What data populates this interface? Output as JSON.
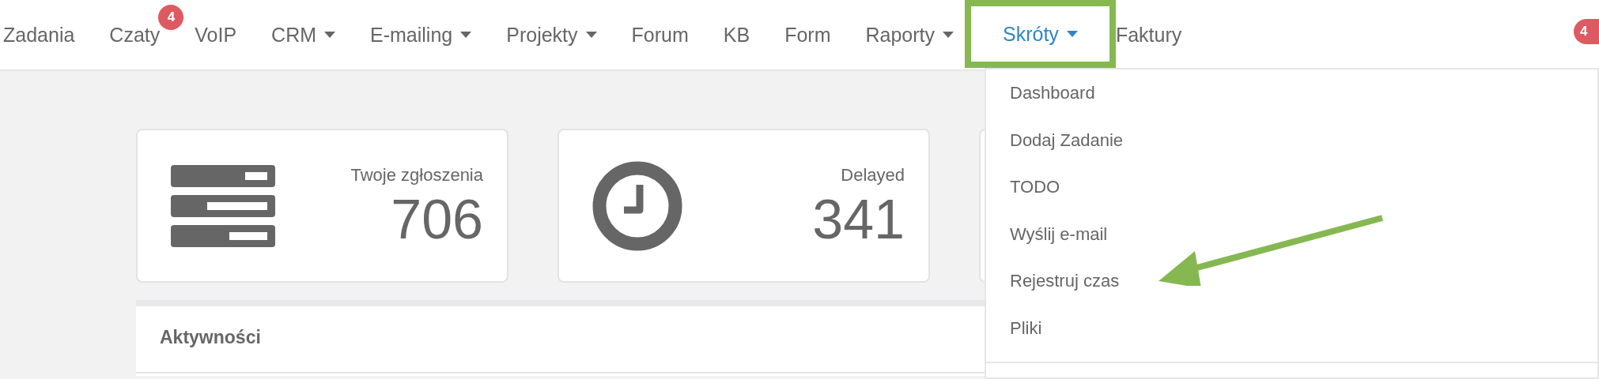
{
  "nav": {
    "items": [
      {
        "label": "Zadania",
        "caret": false,
        "selected": false,
        "highlighted": false
      },
      {
        "label": "Czaty",
        "caret": false,
        "selected": false,
        "highlighted": false,
        "badge": "4"
      },
      {
        "label": "VoIP",
        "caret": false,
        "selected": false,
        "highlighted": false
      },
      {
        "label": "CRM",
        "caret": true,
        "selected": false,
        "highlighted": false
      },
      {
        "label": "E-mailing",
        "caret": true,
        "selected": false,
        "highlighted": false
      },
      {
        "label": "Projekty",
        "caret": true,
        "selected": false,
        "highlighted": false
      },
      {
        "label": "Forum",
        "caret": false,
        "selected": false,
        "highlighted": false
      },
      {
        "label": "KB",
        "caret": false,
        "selected": false,
        "highlighted": false
      },
      {
        "label": "Form",
        "caret": false,
        "selected": false,
        "highlighted": false
      },
      {
        "label": "Raporty",
        "caret": true,
        "selected": false,
        "highlighted": false
      },
      {
        "label": "Skróty",
        "caret": true,
        "selected": true,
        "highlighted": true
      },
      {
        "label": "Faktury",
        "caret": false,
        "selected": false,
        "highlighted": false
      }
    ],
    "right_badge": "4"
  },
  "cards": [
    {
      "kind": "server",
      "title": "Twoje zgłoszenia",
      "value": "706"
    },
    {
      "kind": "clock",
      "title": "Delayed",
      "value": "341"
    }
  ],
  "panel": {
    "title": "Aktywności"
  },
  "dropdown": {
    "items": [
      "Dashboard",
      "Dodaj Zadanie",
      "TODO",
      "Wyślij e-mail",
      "Rejestruj czas",
      "Pliki"
    ]
  }
}
